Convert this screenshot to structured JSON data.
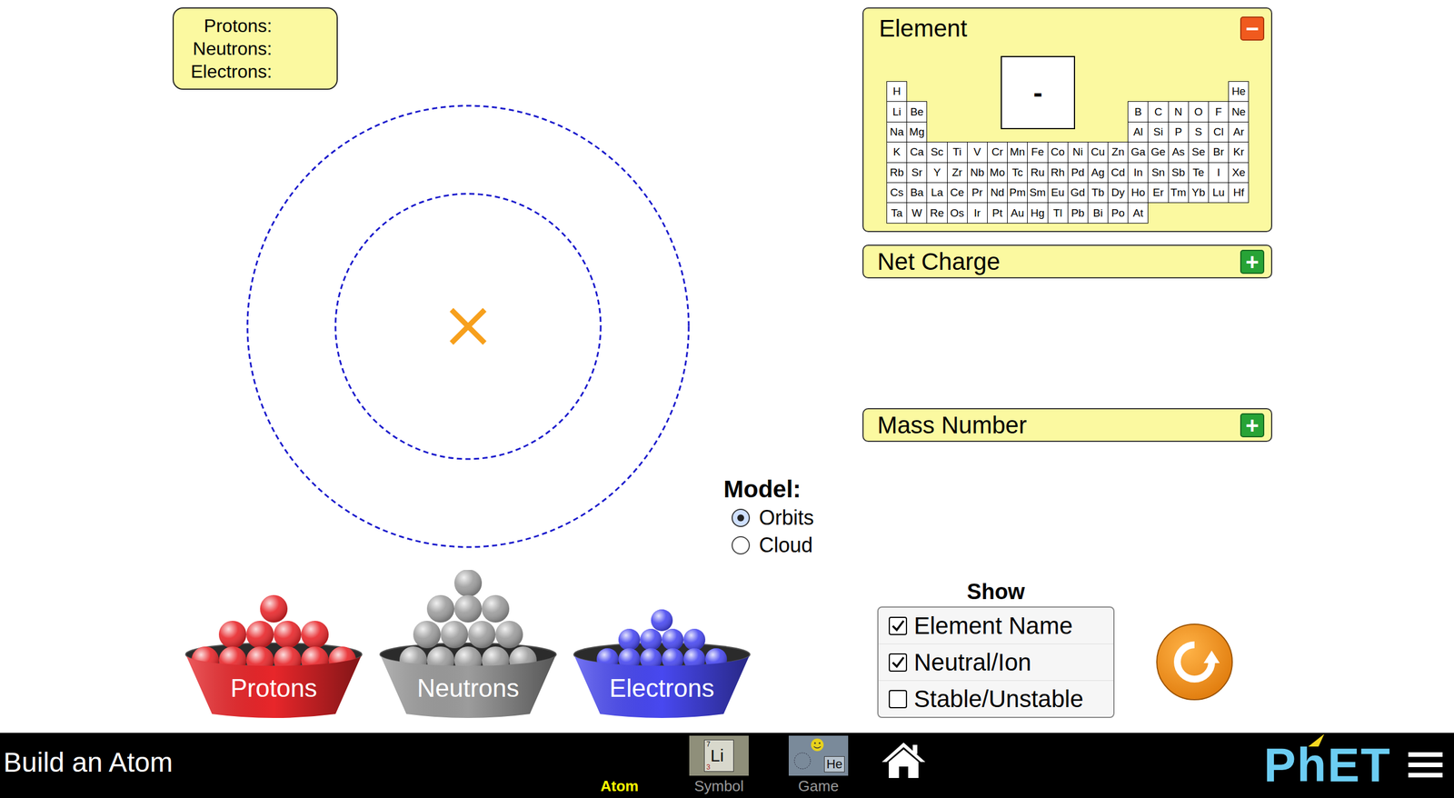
{
  "sim": {
    "title": "Build an Atom"
  },
  "counts": [
    {
      "label": "Protons:",
      "value": ""
    },
    {
      "label": "Neutrons:",
      "value": ""
    },
    {
      "label": "Electrons:",
      "value": ""
    }
  ],
  "element_panel": {
    "title": "Element",
    "expanded": true,
    "toggle": "−",
    "symbol": "-",
    "table": [
      {
        "left": [
          "H"
        ],
        "right": [
          "He"
        ]
      },
      {
        "left": [
          "Li",
          "Be"
        ],
        "right": [
          "B",
          "C",
          "N",
          "O",
          "F",
          "Ne"
        ]
      },
      {
        "left": [
          "Na",
          "Mg"
        ],
        "right": [
          "Al",
          "Si",
          "P",
          "S",
          "Cl",
          "Ar"
        ]
      },
      {
        "left": [
          "K",
          "Ca",
          "Sc",
          "Ti",
          "V",
          "Cr",
          "Mn",
          "Fe",
          "Co",
          "Ni",
          "Cu",
          "Zn",
          "Ga",
          "Ge",
          "As",
          "Se",
          "Br",
          "Kr"
        ],
        "right": []
      },
      {
        "left": [
          "Rb",
          "Sr",
          "Y",
          "Zr",
          "Nb",
          "Mo",
          "Tc",
          "Ru",
          "Rh",
          "Pd",
          "Ag",
          "Cd",
          "In",
          "Sn",
          "Sb",
          "Te",
          "I",
          "Xe"
        ],
        "right": []
      },
      {
        "left": [
          "Cs",
          "Ba",
          "La",
          "Ce",
          "Pr",
          "Nd",
          "Pm",
          "Sm",
          "Eu",
          "Gd",
          "Tb",
          "Dy",
          "Ho",
          "Er",
          "Tm",
          "Yb",
          "Lu",
          "Hf"
        ],
        "right": []
      },
      {
        "left": [
          "Ta",
          "W",
          "Re",
          "Os",
          "Ir",
          "Pt",
          "Au",
          "Hg",
          "Tl",
          "Pb",
          "Bi",
          "Po",
          "At"
        ],
        "right": []
      }
    ]
  },
  "net_charge": {
    "title": "Net Charge",
    "expanded": false,
    "toggle": "+"
  },
  "mass_number": {
    "title": "Mass Number",
    "expanded": false,
    "toggle": "+"
  },
  "model": {
    "label": "Model:",
    "options": [
      {
        "label": "Orbits",
        "selected": true
      },
      {
        "label": "Cloud",
        "selected": false
      }
    ]
  },
  "buckets": [
    {
      "label": "Protons",
      "kind": "proton",
      "color": "#e8262a",
      "rows": [
        1,
        4,
        6
      ]
    },
    {
      "label": "Neutrons",
      "kind": "neutron",
      "color": "#9c9c9c",
      "rows": [
        1,
        3,
        4,
        5
      ]
    },
    {
      "label": "Electrons",
      "kind": "electron",
      "color": "#4848f0",
      "rows": [
        1,
        4,
        6
      ]
    }
  ],
  "show": {
    "title": "Show",
    "options": [
      {
        "label": "Element Name",
        "checked": true
      },
      {
        "label": "Neutral/Ion",
        "checked": true
      },
      {
        "label": "Stable/Unstable",
        "checked": false
      }
    ]
  },
  "tabs": [
    {
      "label": "Atom",
      "kind": "atom",
      "selected": true
    },
    {
      "label": "Symbol",
      "kind": "symbol",
      "selected": false,
      "icon_symbol": "Li",
      "icon_mass": "7",
      "icon_number": "3"
    },
    {
      "label": "Game",
      "kind": "game",
      "selected": false,
      "icon_symbol": "He"
    }
  ],
  "logo": "PhET"
}
